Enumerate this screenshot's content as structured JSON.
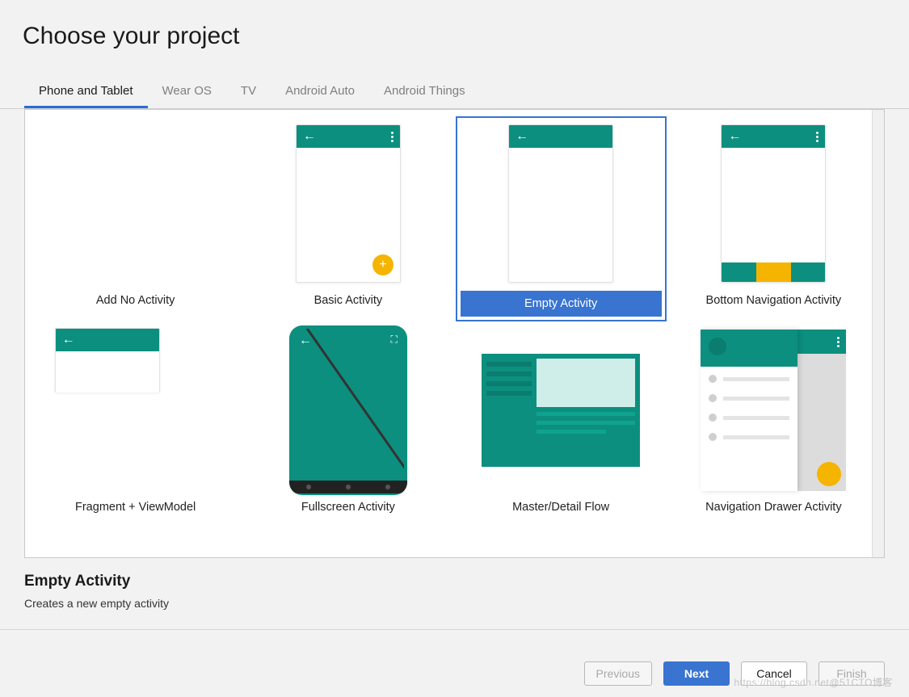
{
  "title": "Choose your project",
  "tabs": [
    "Phone and Tablet",
    "Wear OS",
    "TV",
    "Android Auto",
    "Android Things"
  ],
  "activeTab": 0,
  "templates": [
    {
      "label": "Add No Activity",
      "kind": "none"
    },
    {
      "label": "Basic Activity",
      "kind": "basic"
    },
    {
      "label": "Empty Activity",
      "kind": "empty",
      "selected": true
    },
    {
      "label": "Bottom Navigation Activity",
      "kind": "bottomnav"
    },
    {
      "label": "Fragment + ViewModel",
      "kind": "fragment"
    },
    {
      "label": "Fullscreen Activity",
      "kind": "fullscreen"
    },
    {
      "label": "Master/Detail Flow",
      "kind": "masterdetail"
    },
    {
      "label": "Navigation Drawer Activity",
      "kind": "drawer"
    }
  ],
  "detail": {
    "title": "Empty Activity",
    "description": "Creates a new empty activity"
  },
  "buttons": {
    "previous": "Previous",
    "next": "Next",
    "cancel": "Cancel",
    "finish": "Finish"
  },
  "watermark": "https://blog.csdn.net@51CTO博客"
}
